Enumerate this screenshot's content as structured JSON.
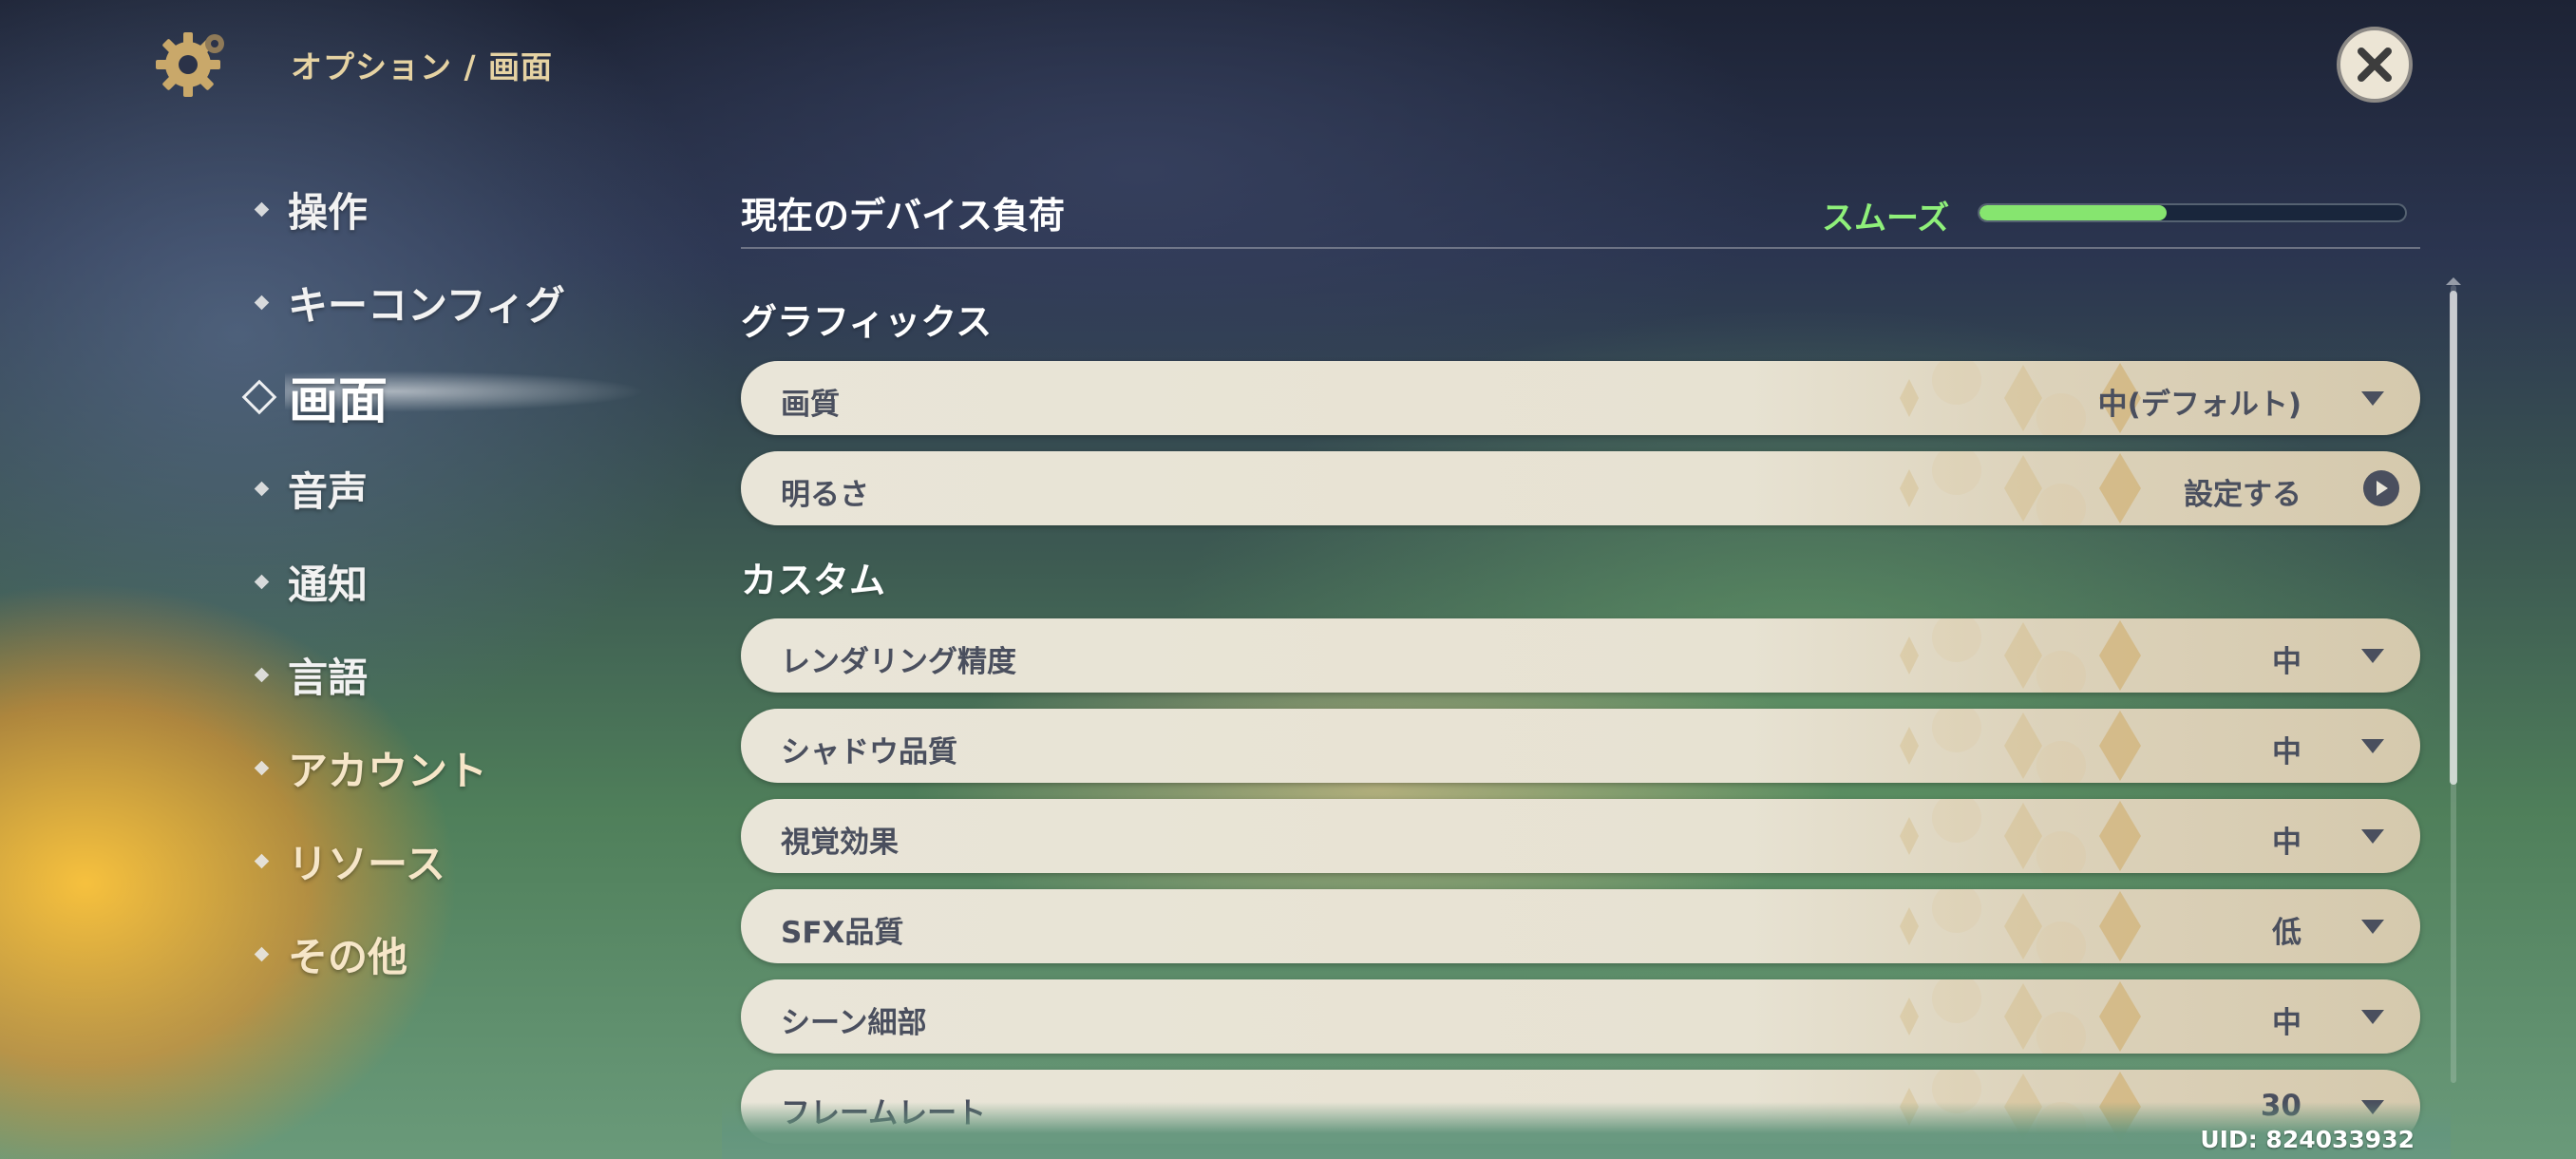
{
  "header": {
    "breadcrumb": "オプション / 画面",
    "settings_icon": "gear-icon",
    "close_icon": "close-icon"
  },
  "sidebar": {
    "items": [
      {
        "label": "操作"
      },
      {
        "label": "キーコンフィグ"
      },
      {
        "label": "画面",
        "active": true
      },
      {
        "label": "音声"
      },
      {
        "label": "通知"
      },
      {
        "label": "言語"
      },
      {
        "label": "アカウント"
      },
      {
        "label": "リソース"
      },
      {
        "label": "その他"
      }
    ]
  },
  "device_load": {
    "title": "現在のデバイス負荷",
    "status": "スムーズ",
    "level_percent": 44,
    "color": "#86e56f"
  },
  "graphics": {
    "title": "グラフィックス",
    "rows": [
      {
        "label": "画質",
        "value": "中(デフォルト)"
      },
      {
        "label": "明るさ",
        "value": "設定する"
      }
    ]
  },
  "custom": {
    "title": "カスタム",
    "rows": [
      {
        "label": "レンダリング精度",
        "value": "中"
      },
      {
        "label": "シャドウ品質",
        "value": "中"
      },
      {
        "label": "視覚効果",
        "value": "中"
      },
      {
        "label": "SFX品質",
        "value": "低"
      },
      {
        "label": "シーン細部",
        "value": "中"
      },
      {
        "label": "フレームレート",
        "value": "30"
      }
    ]
  },
  "uid": "UID: 824033932"
}
